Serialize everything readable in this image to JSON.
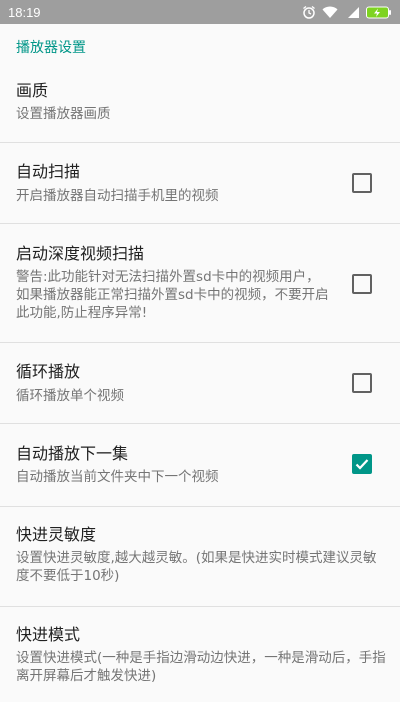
{
  "statusbar": {
    "time": "18:19",
    "icons": [
      "alarm-icon",
      "wifi-icon",
      "4g-signal-icon",
      "battery-charging-icon"
    ]
  },
  "category": "播放器设置",
  "prefs": [
    {
      "title": "画质",
      "summary": "设置播放器画质"
    },
    {
      "title": "自动扫描",
      "summary": "开启播放器自动扫描手机里的视频",
      "checked": false
    },
    {
      "title": "启动深度视频扫描",
      "summary": "警告:此功能针对无法扫描外置sd卡中的视频用户，如果播放器能正常扫描外置sd卡中的视频，不要开启此功能,防止程序异常!",
      "checked": false
    },
    {
      "title": "循环播放",
      "summary": "循环播放单个视频",
      "checked": false
    },
    {
      "title": "自动播放下一集",
      "summary": "自动播放当前文件夹中下一个视频",
      "checked": true
    },
    {
      "title": "快进灵敏度",
      "summary": "设置快进灵敏度,越大越灵敏。(如果是快进实时模式建议灵敏度不要低于10秒)"
    },
    {
      "title": "快进模式",
      "summary": "设置快进模式(一种是手指边滑动边快进，一种是滑动后，手指离开屏幕后才触发快进)"
    }
  ],
  "colors": {
    "accent": "#009688",
    "statusbar": "#9e9e9e",
    "divider": "#e0e0e0"
  }
}
